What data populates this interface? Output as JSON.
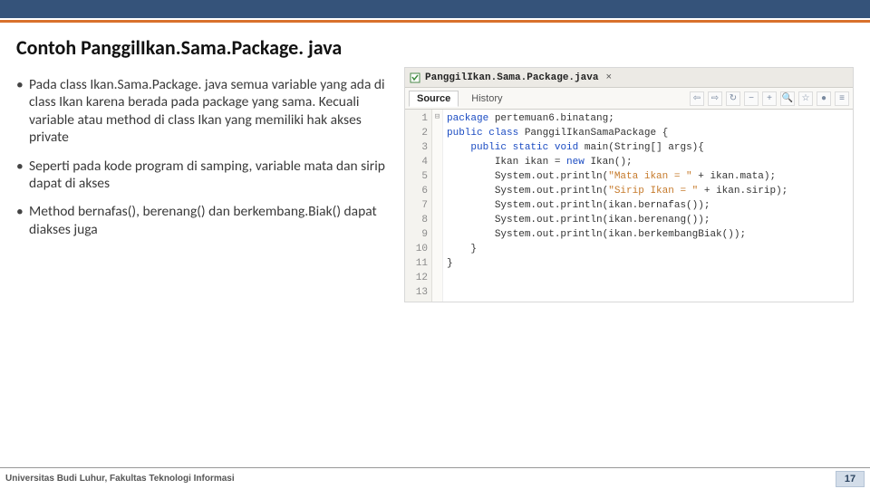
{
  "slide": {
    "title": "Contoh PanggilIkan.Sama.Package. java",
    "bullets": [
      "Pada class Ikan.Sama.Package. java semua variable yang ada di class Ikan karena berada pada package yang sama. Kecuali variable atau method di class Ikan yang memiliki hak akses private",
      "Seperti pada kode program di samping, variable mata dan sirip dapat di akses",
      "Method bernafas(), berenang() dan berkembang.Biak() dapat diakses juga"
    ]
  },
  "editor": {
    "tab_filename": "PanggilIkan.Sama.Package.java",
    "source_tab": "Source",
    "history_tab": "History",
    "line_numbers": [
      "1",
      "2",
      "3",
      "4",
      "5",
      "6",
      "7",
      "8",
      "9",
      "10",
      "11",
      "12",
      "13"
    ],
    "fold_marks": [
      "",
      "",
      "",
      "",
      "⊟",
      "",
      "",
      "",
      "",
      "",
      "",
      "",
      ""
    ],
    "lines": {
      "l1_pre": "",
      "l1_kw": "package",
      "l1_rest": " pertemuan6.binatang;",
      "l2": "",
      "l3_kw1": "public",
      "l3_kw2": "class",
      "l3_rest": " PanggilIkanSamaPackage {",
      "l4_pad": "    ",
      "l4_kw1": "public",
      "l4_kw2": "static",
      "l4_kw3": "void",
      "l4_rest": " main(String[] args){",
      "l5_pad": "        ",
      "l5_a": "Ikan ikan = ",
      "l5_kw": "new",
      "l5_b": " Ikan();",
      "l6_pad": "        ",
      "l6_a": "System.out.println(",
      "l6_str": "\"Mata ikan = \"",
      "l6_b": " + ikan.mata);",
      "l7_pad": "        ",
      "l7_a": "System.out.println(",
      "l7_str": "\"Sirip Ikan = \"",
      "l7_b": " + ikan.sirip);",
      "l8_pad": "        ",
      "l8_a": "System.out.println(ikan.bernafas());",
      "l9_pad": "        ",
      "l9_a": "System.out.println(ikan.berenang());",
      "l10_pad": "        ",
      "l10_a": "System.out.println(ikan.berkembangBiak());",
      "l11": "",
      "l12": "    }",
      "l13": "}"
    }
  },
  "footer": {
    "left": "Universitas Budi Luhur, Fakultas Teknologi Informasi",
    "page": "17"
  }
}
